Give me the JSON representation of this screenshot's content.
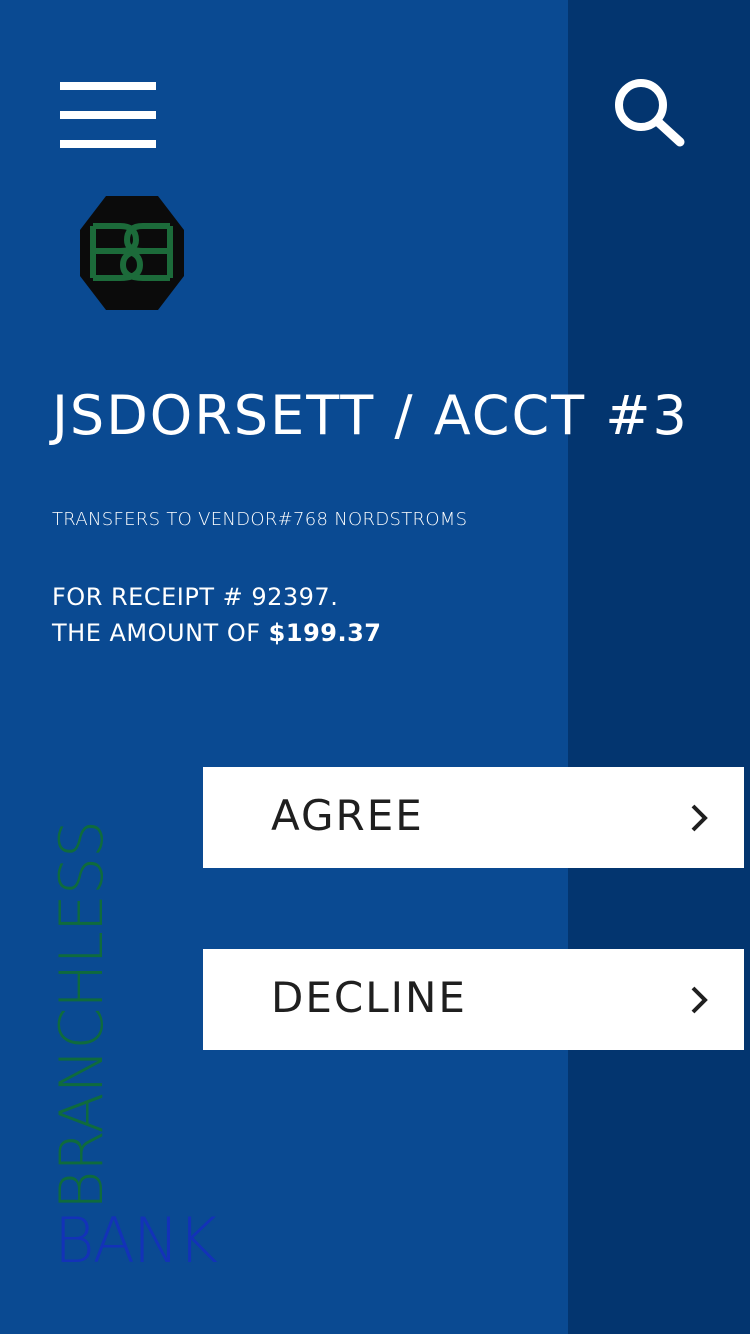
{
  "header": {
    "menu_icon": "hamburger-menu-icon",
    "search_icon": "search-icon"
  },
  "logo": {
    "text": "BB",
    "bg_color": "#0b0b0b",
    "letter_color": "#1c6b3a"
  },
  "account": {
    "title": "JSDORSETT / ACCT #3",
    "transfer_line": "TRANSFERS TO VENDOR#768 NORDSTROMS",
    "receipt_line": "FOR RECEIPT # 92397.",
    "amount_prefix": "THE AMOUNT OF",
    "amount_value": "$199.37"
  },
  "actions": {
    "agree_label": "AGREE",
    "decline_label": "DECLINE",
    "chevron_icon": "chevron-right-icon"
  },
  "brand": {
    "vertical_word": "BRANCHLESS",
    "bottom_word": "BANK"
  },
  "colors": {
    "background": "#0a4a92",
    "side_panel": "#03356f",
    "brand_green": "#0f6b3d",
    "brand_blue": "#1332b8"
  }
}
